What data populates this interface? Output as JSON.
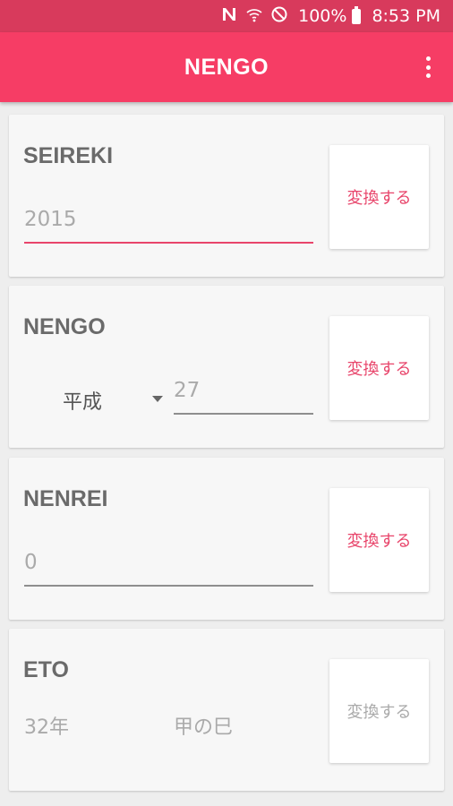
{
  "status_bar": {
    "battery": "100%",
    "time": "8:53 PM"
  },
  "app_bar": {
    "title": "NENGO"
  },
  "cards": {
    "seireki": {
      "title": "SEIREKI",
      "input_value": "2015",
      "button": "変換する"
    },
    "nengo": {
      "title": "NENGO",
      "era": "平成",
      "input_value": "27",
      "button": "変換する"
    },
    "nenrei": {
      "title": "NENREI",
      "input_value": "0",
      "button": "変換する"
    },
    "eto": {
      "title": "ETO",
      "year_value": "32年",
      "eto_value": "甲の巳",
      "button": "変換する"
    }
  },
  "colors": {
    "primary": "#f63d65",
    "primary_dark": "#d83a5c",
    "accent_text": "#e8456b"
  }
}
